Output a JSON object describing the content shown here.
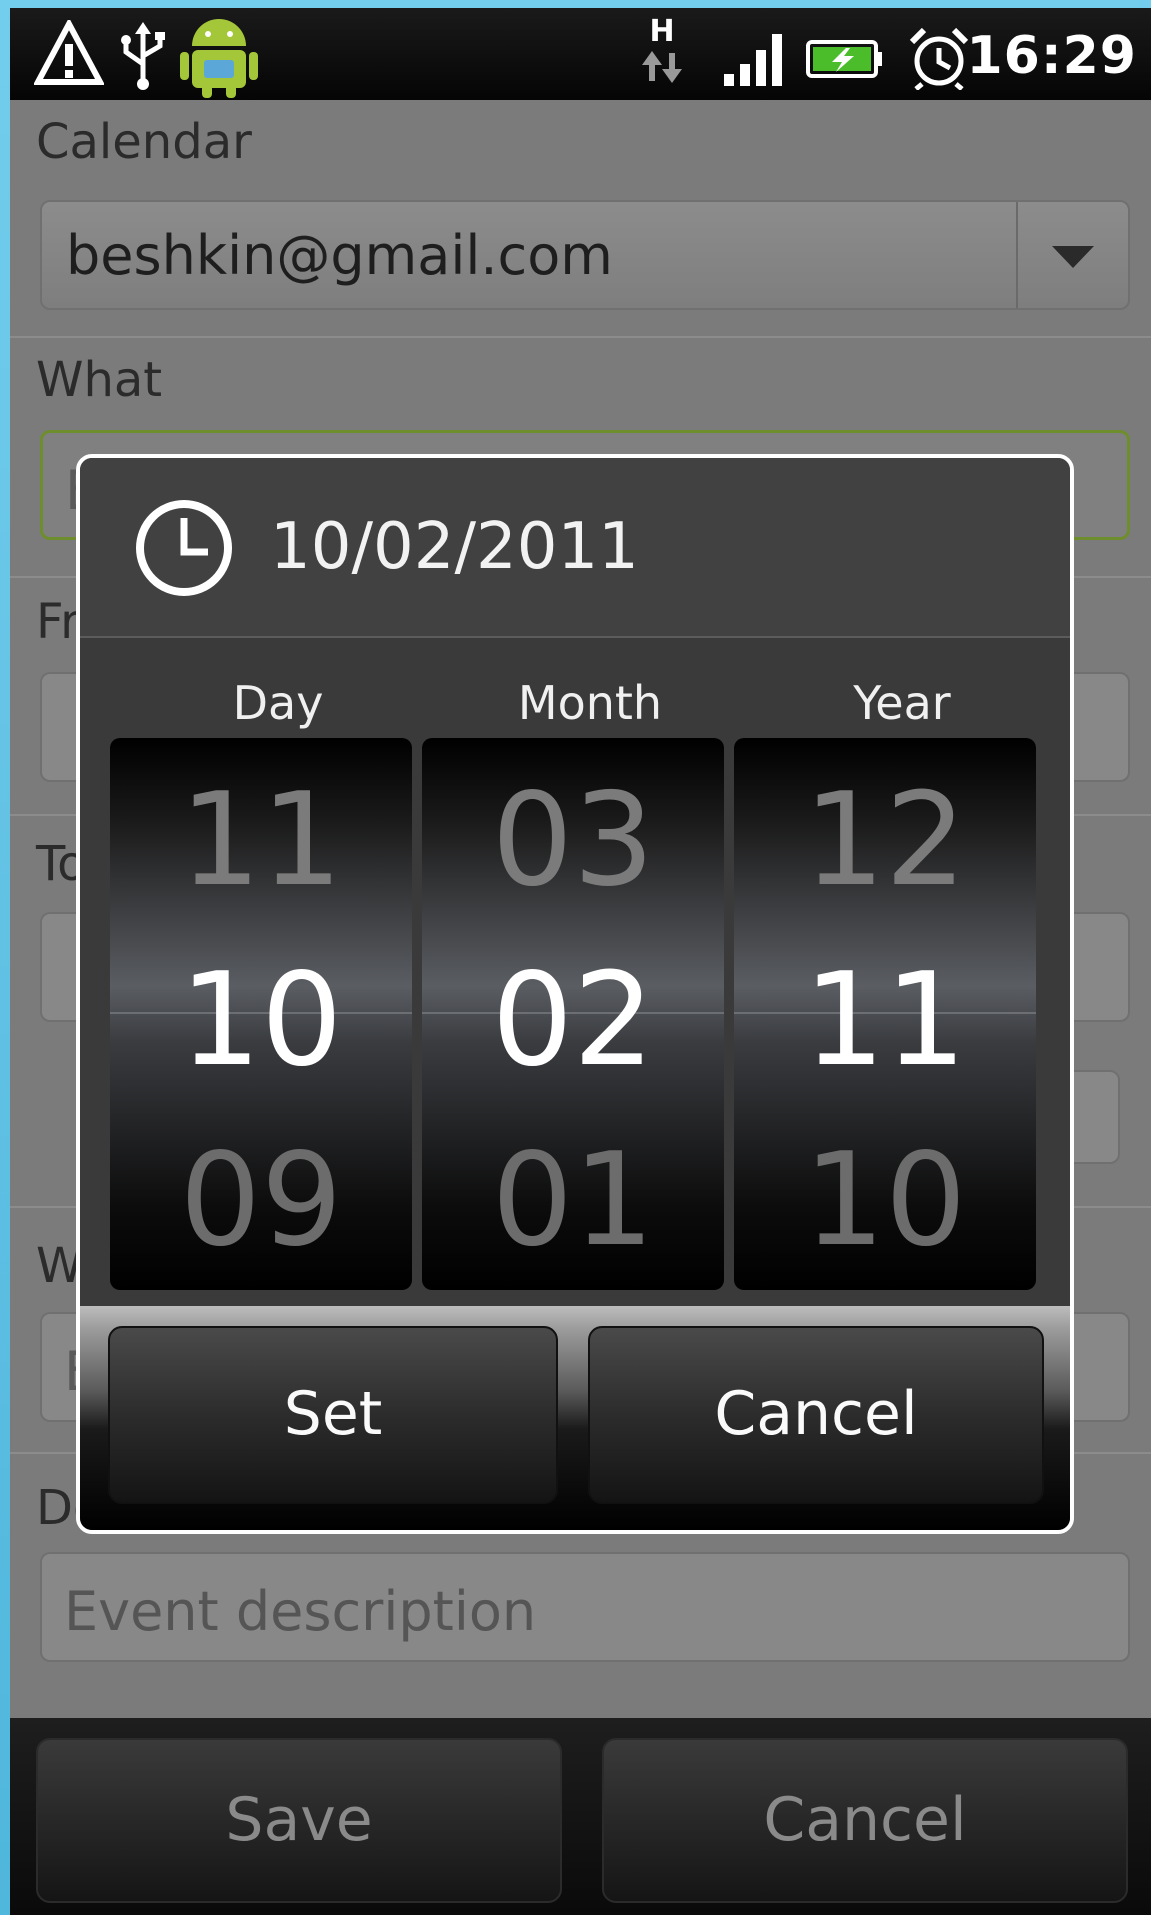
{
  "status_bar": {
    "time": "16:29",
    "icons": [
      "warning-icon",
      "usb-icon",
      "android-icon",
      "hspa-data-icon",
      "signal-icon",
      "battery-charging-icon",
      "alarm-icon"
    ],
    "network_label": "H"
  },
  "form": {
    "calendar_label": "Calendar",
    "calendar_value": "beshkin@gmail.com",
    "what_label": "What",
    "what_placeholder": "E",
    "from_label": "Fr",
    "to_label": "To",
    "where_label": "W",
    "where_placeholder": "E",
    "description_label": "De",
    "description_placeholder": "Event description"
  },
  "bottom_buttons": {
    "save": "Save",
    "cancel": "Cancel"
  },
  "date_dialog": {
    "title": "10/02/2011",
    "columns": {
      "day": {
        "label": "Day",
        "prev": "11",
        "current": "10",
        "next": "09"
      },
      "month": {
        "label": "Month",
        "prev": "03",
        "current": "02",
        "next": "01"
      },
      "year": {
        "label": "Year",
        "prev": "12",
        "current": "11",
        "next": "10"
      }
    },
    "set_button": "Set",
    "cancel_button": "Cancel"
  },
  "colors": {
    "background": "#5bc0e3",
    "dialog_border": "#ffffff",
    "focus_border": "#6e8d2c"
  }
}
